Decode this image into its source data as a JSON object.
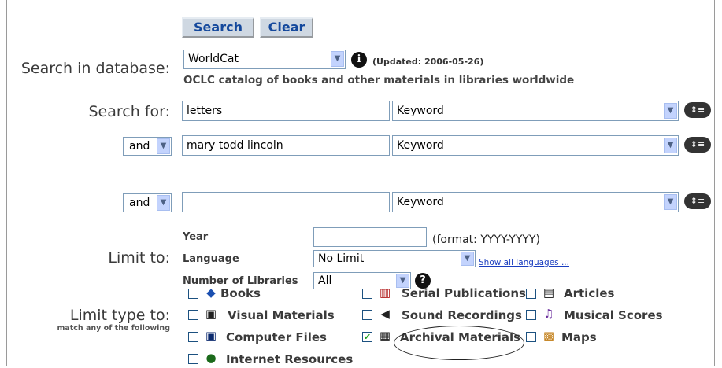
{
  "buttons": {
    "search": "Search",
    "clear": "Clear"
  },
  "database": {
    "label": "Search in database:",
    "selected": "WorldCat",
    "updated": "(Updated: 2006-05-26)",
    "description": "OCLC catalog of books and other materials in libraries worldwide"
  },
  "search": {
    "label": "Search for:",
    "rows": [
      {
        "operator": "",
        "term": "letters",
        "index": "Keyword"
      },
      {
        "operator": "and",
        "term": "mary todd lincoln",
        "index": "Keyword"
      },
      {
        "operator": "and",
        "term": "",
        "index": "Keyword"
      }
    ]
  },
  "limits": {
    "label": "Limit to:",
    "year_label": "Year",
    "year_value": "",
    "year_format": "(format: YYYY-YYYY)",
    "language_label": "Language",
    "language_value": "No Limit",
    "show_all_languages": "Show all languages ...",
    "libraries_label": "Number of Libraries",
    "libraries_value": "All"
  },
  "types": {
    "label": "Limit type to:",
    "sublabel": "match any of the following",
    "items": [
      {
        "label": "Books",
        "checked": false,
        "icon": "books-icon"
      },
      {
        "label": "Serial Publications",
        "checked": false,
        "icon": "serial-publications-icon"
      },
      {
        "label": "Articles",
        "checked": false,
        "icon": "articles-icon"
      },
      {
        "label": "Visual Materials",
        "checked": false,
        "icon": "visual-materials-icon"
      },
      {
        "label": "Sound Recordings",
        "checked": false,
        "icon": "sound-recordings-icon"
      },
      {
        "label": "Musical Scores",
        "checked": false,
        "icon": "musical-scores-icon"
      },
      {
        "label": "Computer Files",
        "checked": false,
        "icon": "computer-files-icon"
      },
      {
        "label": "Archival Materials",
        "checked": true,
        "icon": "archival-materials-icon"
      },
      {
        "label": "Maps",
        "checked": false,
        "icon": "maps-icon"
      },
      {
        "label": "Internet Resources",
        "checked": false,
        "icon": "internet-resources-icon"
      }
    ]
  },
  "colors": {
    "button_text": "#14489c",
    "link": "#1a3dbf",
    "check": "#21a121"
  }
}
